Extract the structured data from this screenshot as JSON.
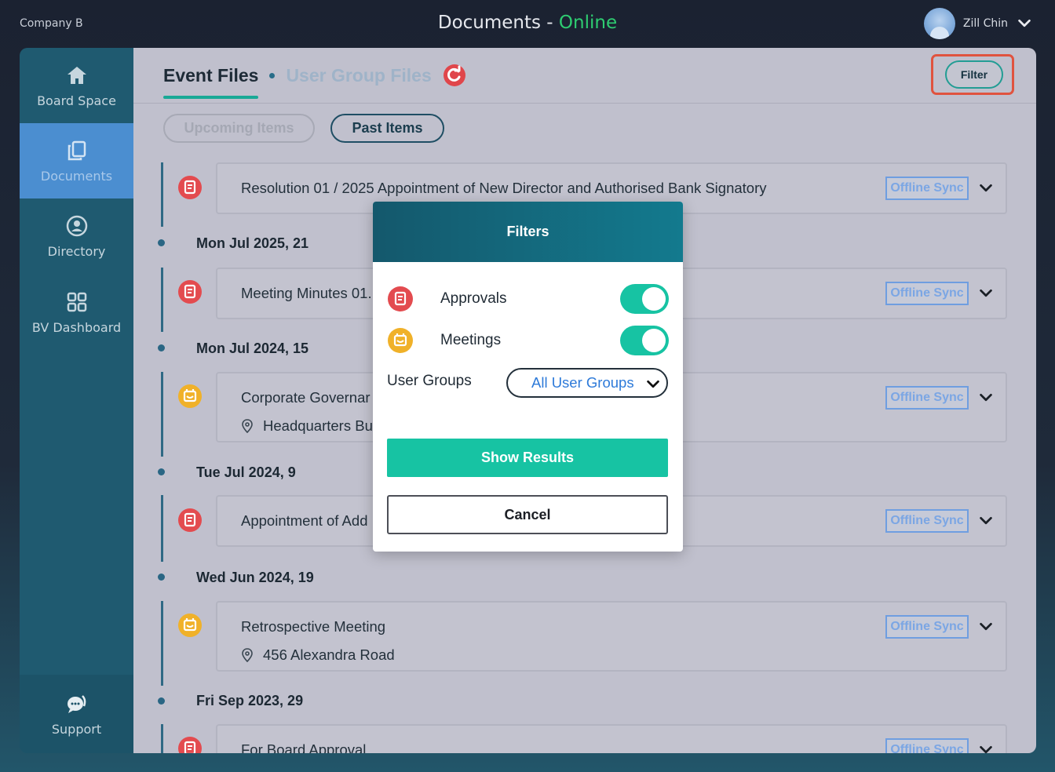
{
  "topbar": {
    "company": "Company B",
    "title": "Documents - ",
    "status": "Online",
    "user_name": "Zill Chin"
  },
  "sidebar": {
    "items": [
      {
        "label": "Board Space",
        "icon": "home-icon"
      },
      {
        "label": "Documents",
        "icon": "documents-icon"
      },
      {
        "label": "Directory",
        "icon": "directory-icon"
      },
      {
        "label": "BV Dashboard",
        "icon": "dashboard-icon"
      }
    ],
    "support": {
      "label": "Support",
      "icon": "support-icon"
    }
  },
  "tabs": {
    "active": "Event Files",
    "inactive": "User Group Files"
  },
  "filter_button": "Filter",
  "pills": {
    "upcoming": "Upcoming Items",
    "past": "Past Items"
  },
  "offline_label": "Offline Sync",
  "dates": [
    "Mon Jul 2025, 21",
    "Mon Jul 2024, 15",
    "Tue Jul 2024, 9",
    "Wed Jun 2024, 19",
    "Fri Sep 2023, 29"
  ],
  "items": [
    {
      "type": "approval",
      "title": "Resolution 01 / 2025 Appointment of New Director and Authorised Bank Signatory"
    },
    {
      "type": "approval",
      "title": "Meeting Minutes 01."
    },
    {
      "type": "meeting",
      "title": "Corporate Governar",
      "location": "Headquarters Bu"
    },
    {
      "type": "approval",
      "title": "Appointment of Add"
    },
    {
      "type": "meeting",
      "title": "Retrospective Meeting",
      "location": "456 Alexandra Road"
    },
    {
      "type": "approval",
      "title": "For Board Approval"
    }
  ],
  "filters": {
    "title": "Filters",
    "approvals_label": "Approvals",
    "approvals_on": true,
    "meetings_label": "Meetings",
    "meetings_on": true,
    "user_groups_label": "User Groups",
    "user_groups_value": "All User Groups",
    "show_results": "Show Results",
    "cancel": "Cancel"
  },
  "colors": {
    "accent_teal": "#17c3a3",
    "online_green": "#2ecc71",
    "approval_red": "#e34b4f",
    "meeting_orange": "#f0b129",
    "highlight_border": "#e0533f"
  }
}
